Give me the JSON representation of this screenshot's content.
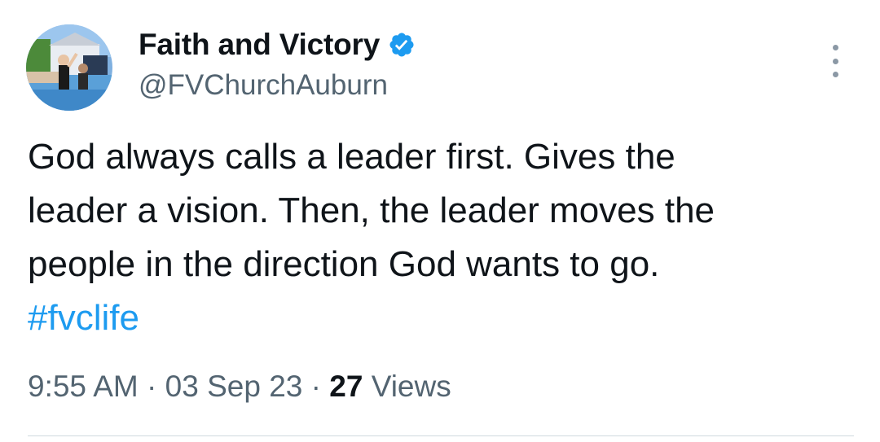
{
  "author": {
    "display_name": "Faith and Victory",
    "handle": "@FVChurchAuburn",
    "verified": true,
    "avatar": "church-baptism-photo"
  },
  "tweet": {
    "lines": [
      "God always calls a leader first.  Gives the",
      "leader a vision.  Then, the leader moves the",
      "people in the direction God wants to go."
    ],
    "hashtag": "#fvclife"
  },
  "meta": {
    "time": "9:55 AM",
    "date": "03 Sep 23",
    "separator": "·",
    "views_count": "27",
    "views_label": "Views"
  },
  "icons": {
    "verified": "verified-badge-icon",
    "more": "more-options-icon"
  },
  "colors": {
    "accent": "#1d9bf0",
    "text": "#0f1419",
    "secondary": "#536471"
  }
}
